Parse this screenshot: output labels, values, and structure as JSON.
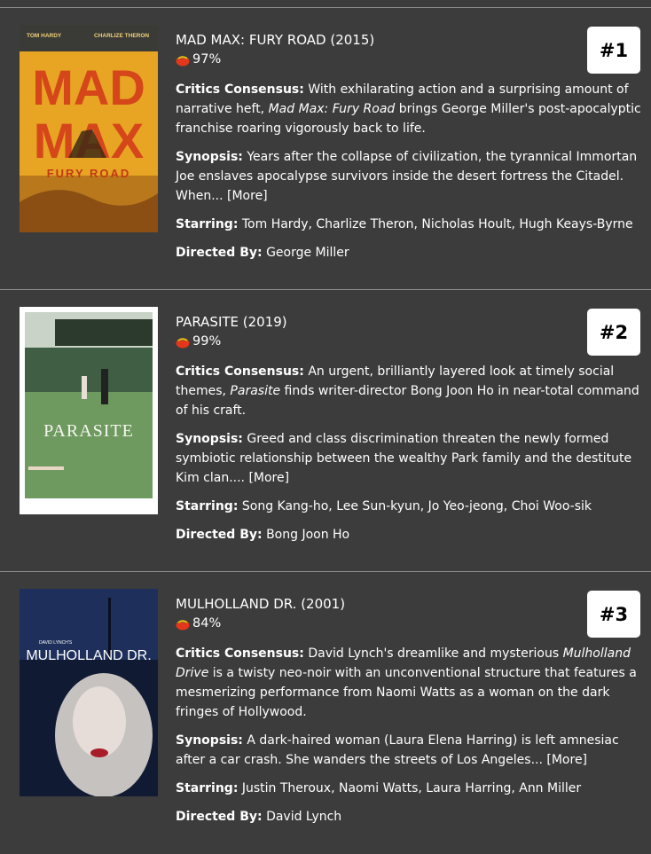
{
  "labels": {
    "consensus": "Critics Consensus:",
    "synopsis": "Synopsis:",
    "starring": "Starring:",
    "directed": "Directed By:",
    "more": "[More]"
  },
  "colors": {
    "background": "#3c3c3c",
    "divider": "#8a8a8a",
    "rank_bg": "#ffffff"
  },
  "movies": [
    {
      "title": "MAD MAX: FURY ROAD (2015)",
      "score": "97%",
      "consensus_pre": "With exhilarating action and a surprising amount of narrative heft, ",
      "consensus_em": "Mad Max: Fury Road",
      "consensus_post": " brings George Miller's post-apocalyptic franchise roaring vigorously back to life.",
      "synopsis": "Years after the collapse of civilization, the tyrannical Immortan Joe enslaves apocalypse survivors inside the desert fortress the Citadel. When... ",
      "starring": "Tom Hardy, Charlize Theron, Nicholas Hoult, Hugh Keays-Byrne",
      "director": "George Miller",
      "rank": "#1",
      "poster": {
        "top_left": "TOM HARDY",
        "top_right": "CHARLIZE THERON",
        "line1": "MAD",
        "line2": "MAX",
        "line3": "FURY ROAD"
      }
    },
    {
      "title": "PARASITE (2019)",
      "score": "99%",
      "consensus_pre": "An urgent, brilliantly layered look at timely social themes, ",
      "consensus_em": "Parasite",
      "consensus_post": " finds writer-director Bong Joon Ho in near-total command of his craft.",
      "synopsis": "Greed and class discrimination threaten the newly formed symbiotic relationship between the wealthy Park family and the destitute Kim clan.... ",
      "starring": "Song Kang-ho, Lee Sun-kyun, Jo Yeo-jeong, Choi Woo-sik",
      "director": "Bong Joon Ho",
      "rank": "#2",
      "poster": {
        "heading": "PARASITE"
      }
    },
    {
      "title": "MULHOLLAND DR. (2001)",
      "score": "84%",
      "consensus_pre": "David Lynch's dreamlike and mysterious ",
      "consensus_em": "Mulholland Drive",
      "consensus_post": " is a twisty neo-noir with an unconventional structure that features a mesmerizing performance from Naomi Watts as a woman on the dark fringes of Hollywood.",
      "synopsis": "A dark-haired woman (Laura Elena Harring) is left amnesiac after a car crash. She wanders the streets of Los Angeles... ",
      "starring": "Justin Theroux, Naomi Watts, Laura Harring, Ann Miller",
      "director": "David Lynch",
      "rank": "#3",
      "poster": {
        "small": "DAVID LYNCH'S",
        "heading": "MULHOLLAND DR."
      }
    }
  ]
}
